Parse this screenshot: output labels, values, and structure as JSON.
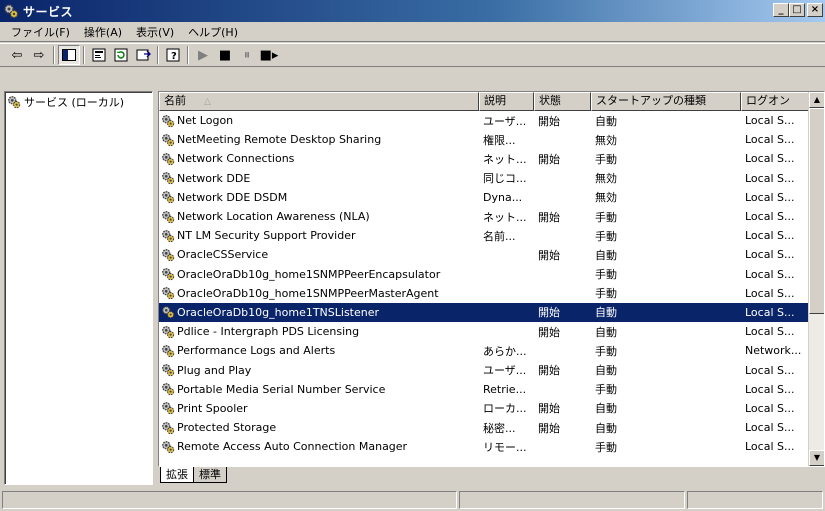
{
  "window": {
    "title": "サービス"
  },
  "menu": [
    "ファイル(F)",
    "操作(A)",
    "表示(V)",
    "ヘルプ(H)"
  ],
  "tree": {
    "root_label": "サービス (ローカル)"
  },
  "columns": {
    "name": "名前",
    "desc": "説明",
    "status": "状態",
    "startup": "スタートアップの種類",
    "logon": "ログオン"
  },
  "services": [
    {
      "name": "Net Logon",
      "desc": "ユーザ...",
      "status": "開始",
      "startup": "自動",
      "logon": "Local S..."
    },
    {
      "name": "NetMeeting Remote Desktop Sharing",
      "desc": "権限...",
      "status": "",
      "startup": "無効",
      "logon": "Local S..."
    },
    {
      "name": "Network Connections",
      "desc": "ネット...",
      "status": "開始",
      "startup": "手動",
      "logon": "Local S..."
    },
    {
      "name": "Network DDE",
      "desc": "同じコ...",
      "status": "",
      "startup": "無効",
      "logon": "Local S..."
    },
    {
      "name": "Network DDE DSDM",
      "desc": "Dyna...",
      "status": "",
      "startup": "無効",
      "logon": "Local S..."
    },
    {
      "name": "Network Location Awareness (NLA)",
      "desc": "ネット...",
      "status": "開始",
      "startup": "手動",
      "logon": "Local S..."
    },
    {
      "name": "NT LM Security Support Provider",
      "desc": "名前...",
      "status": "",
      "startup": "手動",
      "logon": "Local S..."
    },
    {
      "name": "OracleCSService",
      "desc": "",
      "status": "開始",
      "startup": "自動",
      "logon": "Local S..."
    },
    {
      "name": "OracleOraDb10g_home1SNMPPeerEncapsulator",
      "desc": "",
      "status": "",
      "startup": "手動",
      "logon": "Local S..."
    },
    {
      "name": "OracleOraDb10g_home1SNMPPeerMasterAgent",
      "desc": "",
      "status": "",
      "startup": "手動",
      "logon": "Local S..."
    },
    {
      "name": "OracleOraDb10g_home1TNSListener",
      "desc": "",
      "status": "開始",
      "startup": "自動",
      "logon": "Local S...",
      "selected": true
    },
    {
      "name": "Pdlice - Intergraph PDS Licensing",
      "desc": "",
      "status": "開始",
      "startup": "自動",
      "logon": "Local S..."
    },
    {
      "name": "Performance Logs and Alerts",
      "desc": "あらか...",
      "status": "",
      "startup": "手動",
      "logon": "Network..."
    },
    {
      "name": "Plug and Play",
      "desc": "ユーザ...",
      "status": "開始",
      "startup": "自動",
      "logon": "Local S..."
    },
    {
      "name": "Portable Media Serial Number Service",
      "desc": "Retrie...",
      "status": "",
      "startup": "手動",
      "logon": "Local S..."
    },
    {
      "name": "Print Spooler",
      "desc": "ローカ...",
      "status": "開始",
      "startup": "自動",
      "logon": "Local S..."
    },
    {
      "name": "Protected Storage",
      "desc": "秘密...",
      "status": "開始",
      "startup": "自動",
      "logon": "Local S..."
    },
    {
      "name": "Remote Access Auto Connection Manager",
      "desc": "リモー...",
      "status": "",
      "startup": "手動",
      "logon": "Local S..."
    }
  ],
  "tabs": [
    "拡張",
    "標準"
  ],
  "colors": {
    "selection": "#0a246a",
    "face": "#d4d0c8"
  },
  "icons": {
    "service": "gear-icon",
    "back": "back-arrow-icon",
    "forward": "forward-arrow-icon"
  }
}
